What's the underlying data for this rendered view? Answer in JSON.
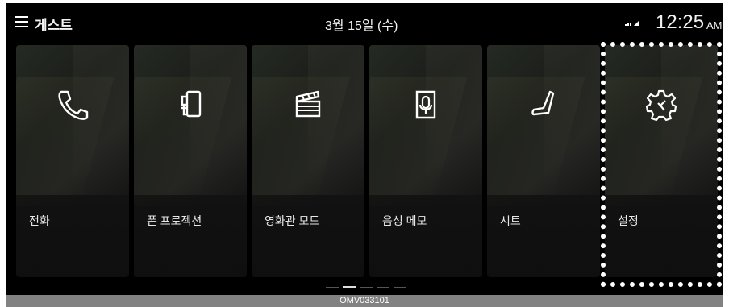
{
  "header": {
    "profile": "게스트",
    "date": "3월 15일 (수)",
    "time": "12:25",
    "ampm": "AM"
  },
  "tiles": [
    {
      "label": "전화",
      "icon": "phone-icon"
    },
    {
      "label": "폰 프로젝션",
      "icon": "phone-projection-icon"
    },
    {
      "label": "영화관 모드",
      "icon": "clapperboard-icon"
    },
    {
      "label": "음성 메모",
      "icon": "voice-memo-icon"
    },
    {
      "label": "시트",
      "icon": "seat-icon"
    },
    {
      "label": "설정",
      "icon": "gear-icon"
    }
  ],
  "pager": {
    "pages": 5,
    "active": 2
  },
  "caption": "OMV033101"
}
